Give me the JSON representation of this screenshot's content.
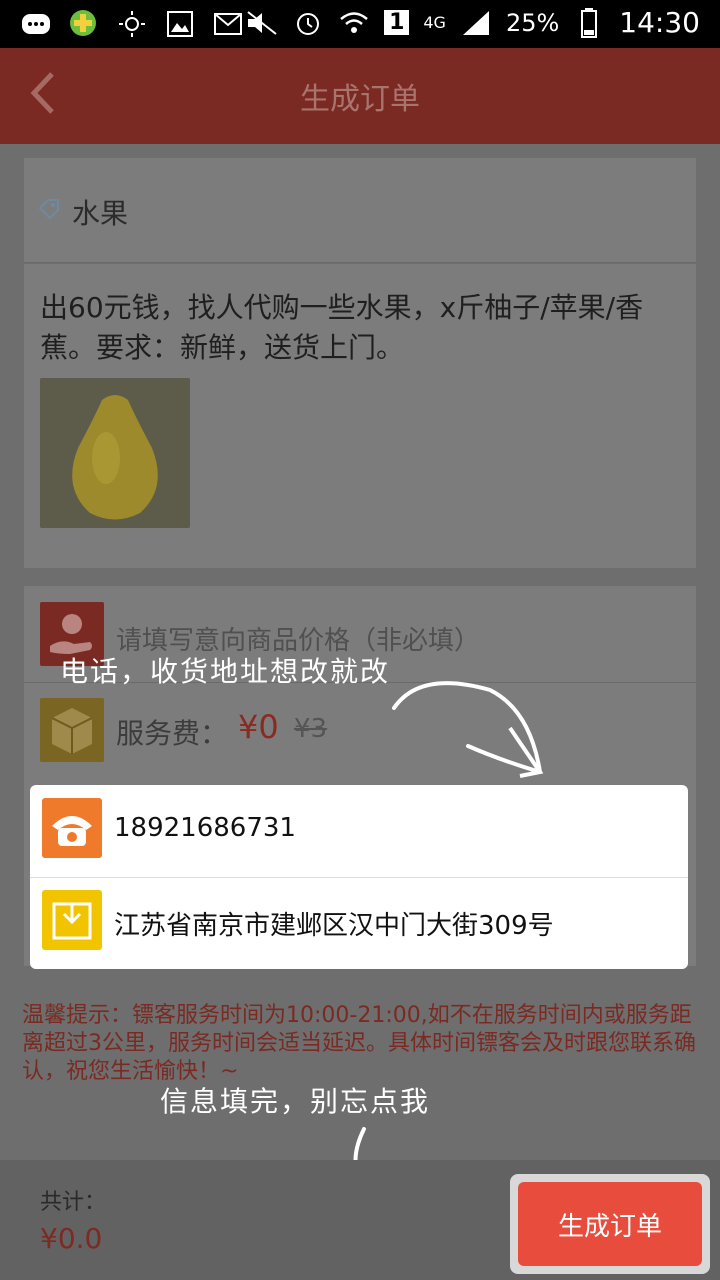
{
  "status_bar": {
    "battery": "25%",
    "time": "14:30",
    "network": "4G",
    "sim": "1"
  },
  "header": {
    "title": "生成订单"
  },
  "category": {
    "label": "水果"
  },
  "request": {
    "description": "出60元钱，找人代购一些水果，x斤柚子/苹果/香蕉。要求：新鲜，送货上门。"
  },
  "options": {
    "price_placeholder": "请填写意向商品价格（非必填）",
    "service_fee_label": "服务费：",
    "service_fee_value": "¥0",
    "service_fee_original": "¥3"
  },
  "contact": {
    "phone": "18921686731",
    "address": "江苏省南京市建邺区汉中门大街309号"
  },
  "notice": {
    "text": "温馨提示：镖客服务时间为10:00-21:00,如不在服务时间内或服务距离超过3公里，服务时间会适当延迟。具体时间镖客会及时跟您联系确认，祝您生活愉快！~"
  },
  "tips": {
    "edit_hint": "电话，收货地址想改就改",
    "submit_hint": "信息填完，别忘点我"
  },
  "footer": {
    "total_label": "共计：",
    "total_value": "¥0.0",
    "submit_label": "生成订单"
  },
  "colors": {
    "accent": "#e74c3c",
    "phone_icon_bg": "#f07a2b",
    "address_icon_bg": "#f2c400"
  }
}
